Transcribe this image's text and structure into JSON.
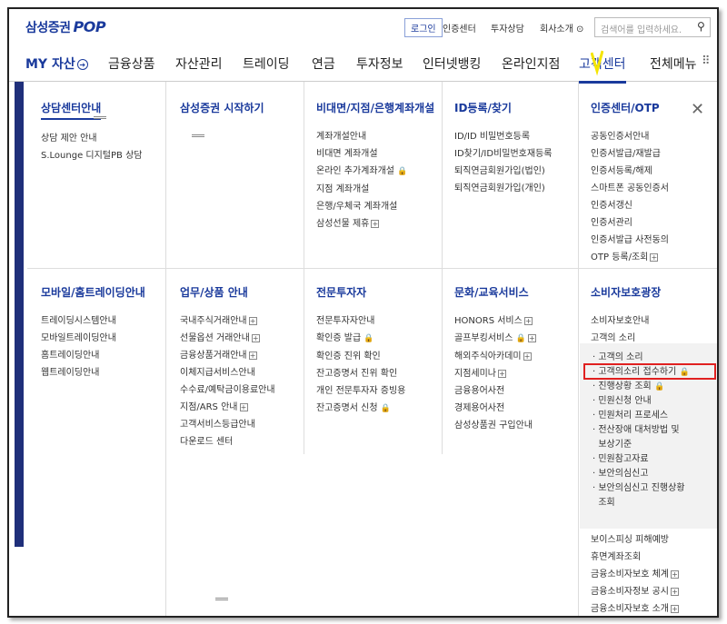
{
  "header": {
    "logo_text": "삼성증권",
    "logo_pop": "POP",
    "login": "로그인",
    "util_links": [
      "인증센터",
      "투자상담",
      "회사소개"
    ],
    "search_placeholder": "검색어를 입력하세요."
  },
  "nav": {
    "items": [
      "MY 자산",
      "금융상품",
      "자산관리",
      "트레이딩",
      "연금",
      "투자정보",
      "인터넷뱅킹",
      "온라인지점",
      "고객센터",
      "전체메뉴"
    ]
  },
  "menu": {
    "col1a": {
      "title": "상담센터안내",
      "items": [
        "상담 제안 안내",
        "S.Lounge 디지털PB 상담"
      ]
    },
    "col2a": {
      "title": "삼성증권 시작하기",
      "items": []
    },
    "col3a": {
      "title": "비대면/지점/은행계좌개설",
      "items": [
        "계좌개설안내",
        "비대면 계좌개설",
        "온라인 추가계좌개설",
        "지점 계좌개설",
        "은행/우체국 계좌개설",
        "삼성선물 제휴"
      ]
    },
    "col4a": {
      "title": "ID등록/찾기",
      "items": [
        "ID/ID 비밀번호등록",
        "ID찾기/ID비밀번호재등록",
        "퇴직연금회원가입(법인)",
        "퇴직연금회원가입(개인)"
      ]
    },
    "col5a": {
      "title": "인증센터/OTP",
      "items": [
        "공동인증서안내",
        "인증서발급/재발급",
        "인증서등록/해제",
        "스마트폰 공동인증서",
        "인증서갱신",
        "인증서관리",
        "인증서발급 사전동의",
        "OTP 등록/조회"
      ]
    },
    "col1b": {
      "title": "모바일/홈트레이딩안내",
      "items": [
        "트레이딩시스템안내",
        "모바일트레이딩안내",
        "홈트레이딩안내",
        "웹트레이딩안내"
      ]
    },
    "col2b": {
      "title": "업무/상품 안내",
      "items": [
        "국내주식거래안내",
        "선물옵션 거래안내",
        "금융상품거래안내",
        "이체지급서비스안내",
        "수수료/예탁금이용료안내",
        "지점/ARS 안내",
        "고객서비스등급안내",
        "다운로드 센터"
      ]
    },
    "col3b": {
      "title": "전문투자자",
      "items": [
        "전문투자자안내",
        "확인증 발급",
        "확인증 진위 확인",
        "잔고증명서 진위 확인",
        "개인 전문투자자 증빙용",
        "잔고증명서 신청"
      ]
    },
    "col4b": {
      "title": "문화/교육서비스",
      "items": [
        "HONORS 서비스",
        "골프부킹서비스",
        "해외주식아카데미",
        "지점세미나",
        "금융용어사전",
        "경제용어사전",
        "삼성상품권 구입안내"
      ]
    },
    "col5b": {
      "title": "소비자보호광장",
      "items": [
        "소비자보호안내",
        "고객의 소리"
      ],
      "sub": [
        "· 고객의 소리",
        "· 고객의소리 접수하기",
        "· 진행상황 조회",
        "· 민원신청 안내",
        "· 민원처리 프로세스",
        "· 전산장애 대처방법 및",
        "  보상기준",
        "· 민원참고자료",
        "· 보안의심신고",
        "· 보안의심신고 진행상황",
        "  조회"
      ],
      "tail": [
        "보이스피싱 피해예방",
        "휴면계좌조회",
        "금융소비자보호 체계",
        "금융소비자정보 공시",
        "금융소비자보호 소개"
      ]
    }
  }
}
